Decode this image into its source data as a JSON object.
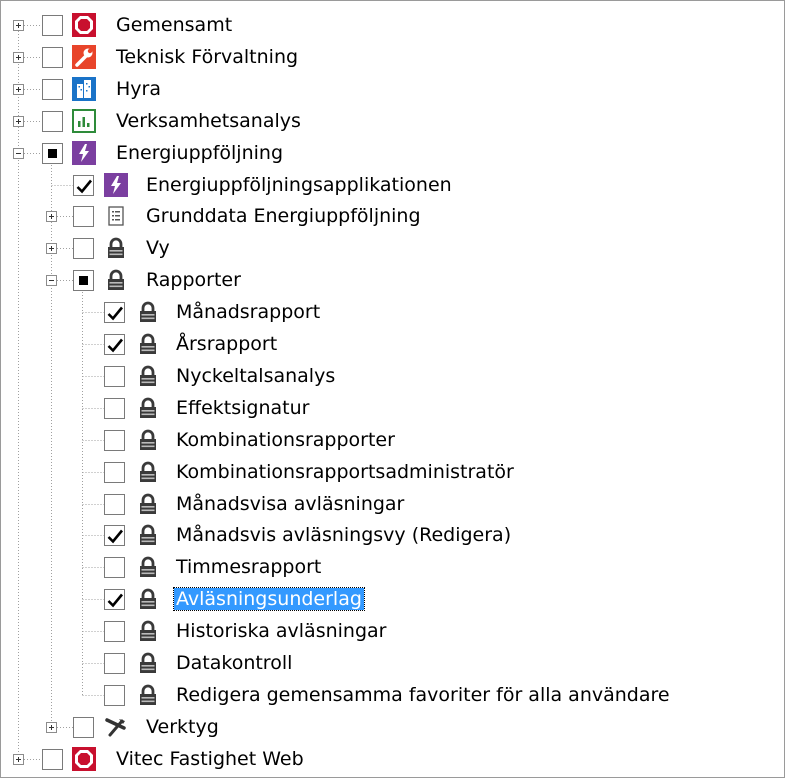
{
  "tree": {
    "nodes": [
      {
        "label": "Gemensamt",
        "icon": "red-octagon-icon",
        "expander": "plus",
        "check": "unchecked",
        "level": 0
      },
      {
        "label": "Teknisk Förvaltning",
        "icon": "wrench-icon",
        "expander": "plus",
        "check": "unchecked",
        "level": 0
      },
      {
        "label": "Hyra",
        "icon": "building-icon",
        "expander": "plus",
        "check": "unchecked",
        "level": 0
      },
      {
        "label": "Verksamhetsanalys",
        "icon": "bar-chart-icon",
        "expander": "plus",
        "check": "unchecked",
        "level": 0
      },
      {
        "label": "Energiuppföljning",
        "icon": "lightning-icon",
        "expander": "minus",
        "check": "partial",
        "level": 0
      },
      {
        "label": "Energiuppföljningsapplikationen",
        "icon": "lightning-icon",
        "expander": "none",
        "check": "checked",
        "level": 1
      },
      {
        "label": "Grunddata Energiuppföljning",
        "icon": "document-icon",
        "expander": "plus",
        "check": "unchecked",
        "level": 1
      },
      {
        "label": "Vy",
        "icon": "padlock-icon",
        "expander": "plus",
        "check": "unchecked",
        "level": 1
      },
      {
        "label": "Rapporter",
        "icon": "padlock-icon",
        "expander": "minus",
        "check": "partial",
        "level": 1
      },
      {
        "label": "Månadsrapport",
        "icon": "padlock-icon",
        "expander": "none",
        "check": "checked",
        "level": 2
      },
      {
        "label": "Årsrapport",
        "icon": "padlock-icon",
        "expander": "none",
        "check": "checked",
        "level": 2
      },
      {
        "label": "Nyckeltalsanalys",
        "icon": "padlock-icon",
        "expander": "none",
        "check": "unchecked",
        "level": 2
      },
      {
        "label": "Effektsignatur",
        "icon": "padlock-icon",
        "expander": "none",
        "check": "unchecked",
        "level": 2
      },
      {
        "label": "Kombinationsrapporter",
        "icon": "padlock-icon",
        "expander": "none",
        "check": "unchecked",
        "level": 2
      },
      {
        "label": "Kombinationsrapportsadministratör",
        "icon": "padlock-icon",
        "expander": "none",
        "check": "unchecked",
        "level": 2
      },
      {
        "label": "Månadsvisa avläsningar",
        "icon": "padlock-icon",
        "expander": "none",
        "check": "unchecked",
        "level": 2
      },
      {
        "label": "Månadsvis avläsningsvy (Redigera)",
        "icon": "padlock-icon",
        "expander": "none",
        "check": "checked",
        "level": 2
      },
      {
        "label": "Timmesrapport",
        "icon": "padlock-icon",
        "expander": "none",
        "check": "unchecked",
        "level": 2
      },
      {
        "label": "Avläsningsunderlag",
        "icon": "padlock-icon",
        "expander": "none",
        "check": "checked",
        "level": 2,
        "selected": true
      },
      {
        "label": "Historiska avläsningar",
        "icon": "padlock-icon",
        "expander": "none",
        "check": "unchecked",
        "level": 2
      },
      {
        "label": "Datakontroll",
        "icon": "padlock-icon",
        "expander": "none",
        "check": "unchecked",
        "level": 2
      },
      {
        "label": "Redigera gemensamma favoriter för alla användare",
        "icon": "padlock-icon",
        "expander": "none",
        "check": "unchecked",
        "level": 2
      },
      {
        "label": "Verktyg",
        "icon": "tools-icon",
        "expander": "plus",
        "check": "unchecked",
        "level": 1
      },
      {
        "label": "Vitec Fastighet Web",
        "icon": "red-octagon-icon",
        "expander": "plus",
        "check": "unchecked",
        "level": 0
      }
    ]
  },
  "colors": {
    "selection": "#3399ff",
    "octagon": "#c8102e",
    "wrench": "#e8442a",
    "building": "#1a73c8",
    "chart": "#2e8b3a",
    "lightning": "#7b3fa0"
  }
}
